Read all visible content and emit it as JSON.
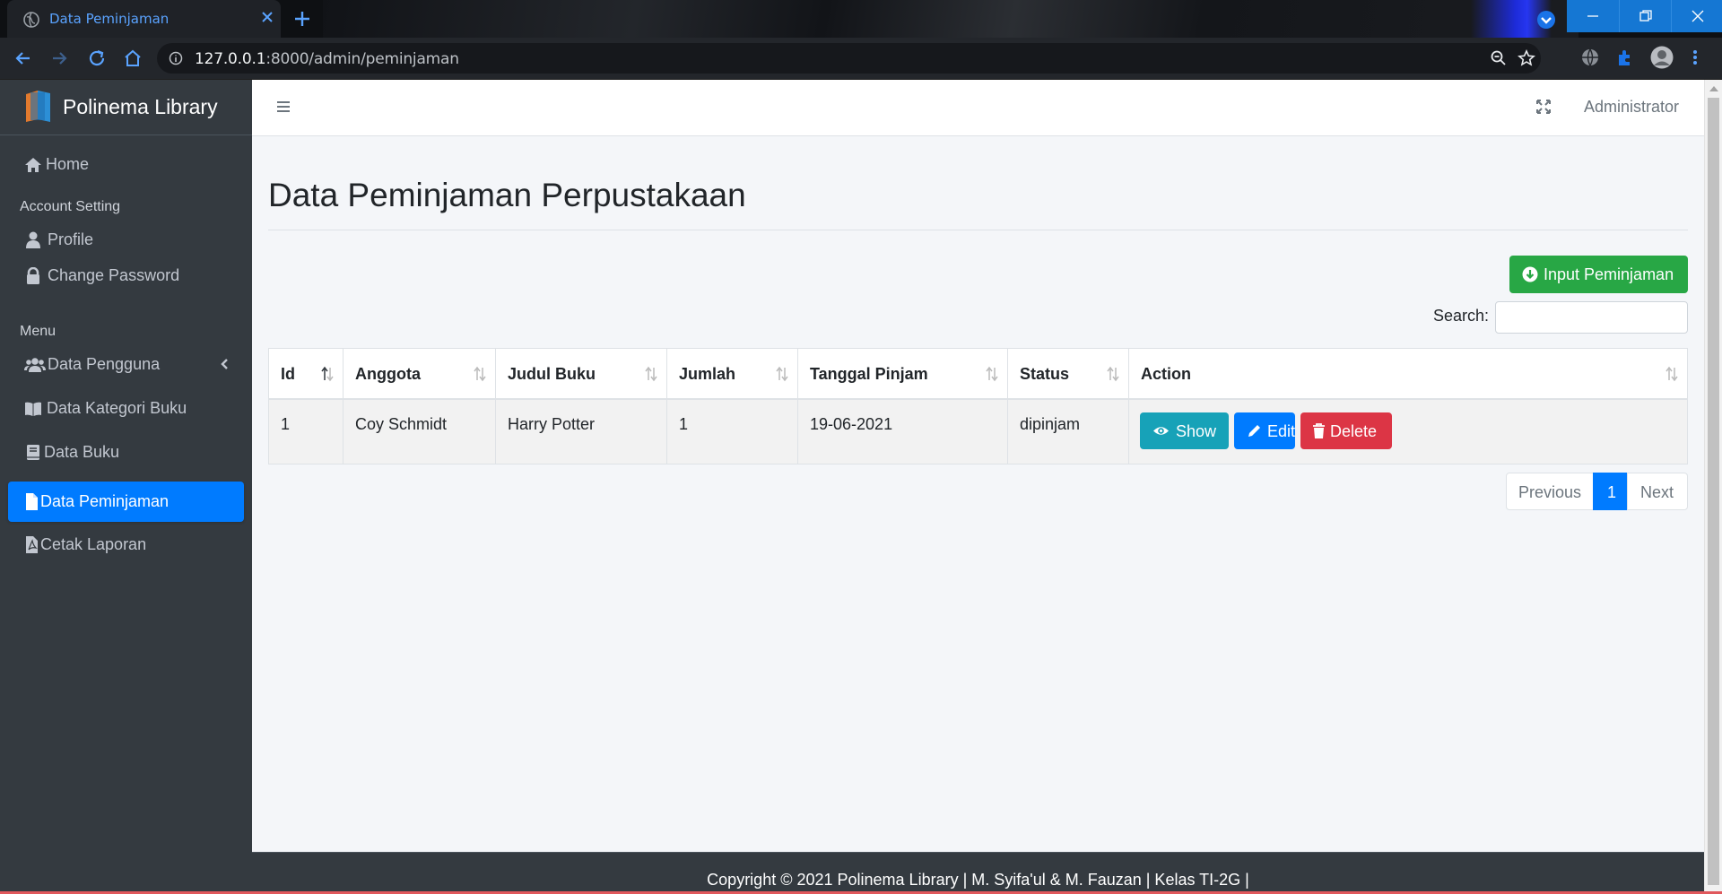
{
  "browser": {
    "tab_title": "Data Peminjaman",
    "url_host": "127.0.0.1",
    "url_rest": ":8000/admin/peminjaman"
  },
  "sidebar": {
    "brand": "Polinema Library",
    "home": "Home",
    "header_account": "Account Setting",
    "profile": "Profile",
    "change_password": "Change Password",
    "header_menu": "Menu",
    "data_pengguna": "Data Pengguna",
    "data_kategori": "Data Kategori Buku",
    "data_buku": "Data Buku",
    "data_peminjaman": "Data Peminjaman",
    "cetak_laporan": "Cetak Laporan"
  },
  "topnav": {
    "user": "Administrator"
  },
  "page": {
    "title": "Data Peminjaman Perpustakaan",
    "input_button": "Input Peminjaman",
    "search_label": "Search:",
    "search_value": ""
  },
  "table": {
    "columns": [
      "Id",
      "Anggota",
      "Judul Buku",
      "Jumlah",
      "Tanggal Pinjam",
      "Status",
      "Action"
    ],
    "rows": [
      {
        "id": "1",
        "anggota": "Coy Schmidt",
        "judul": "Harry Potter",
        "jumlah": "1",
        "tanggal": "19-06-2021",
        "status": "dipinjam"
      }
    ],
    "actions": {
      "show": "Show",
      "edit": "Edit",
      "delete": "Delete"
    }
  },
  "pagination": {
    "previous": "Previous",
    "current": "1",
    "next": "Next"
  },
  "footer": {
    "text": "Copyright © 2021 Polinema Library | M. Syifa'ul & M. Fauzan | Kelas TI-2G |"
  },
  "colors": {
    "sidebar_bg": "#343a40",
    "primary": "#007bff",
    "success": "#28a745",
    "info": "#17a2b8",
    "danger": "#dc3545"
  }
}
